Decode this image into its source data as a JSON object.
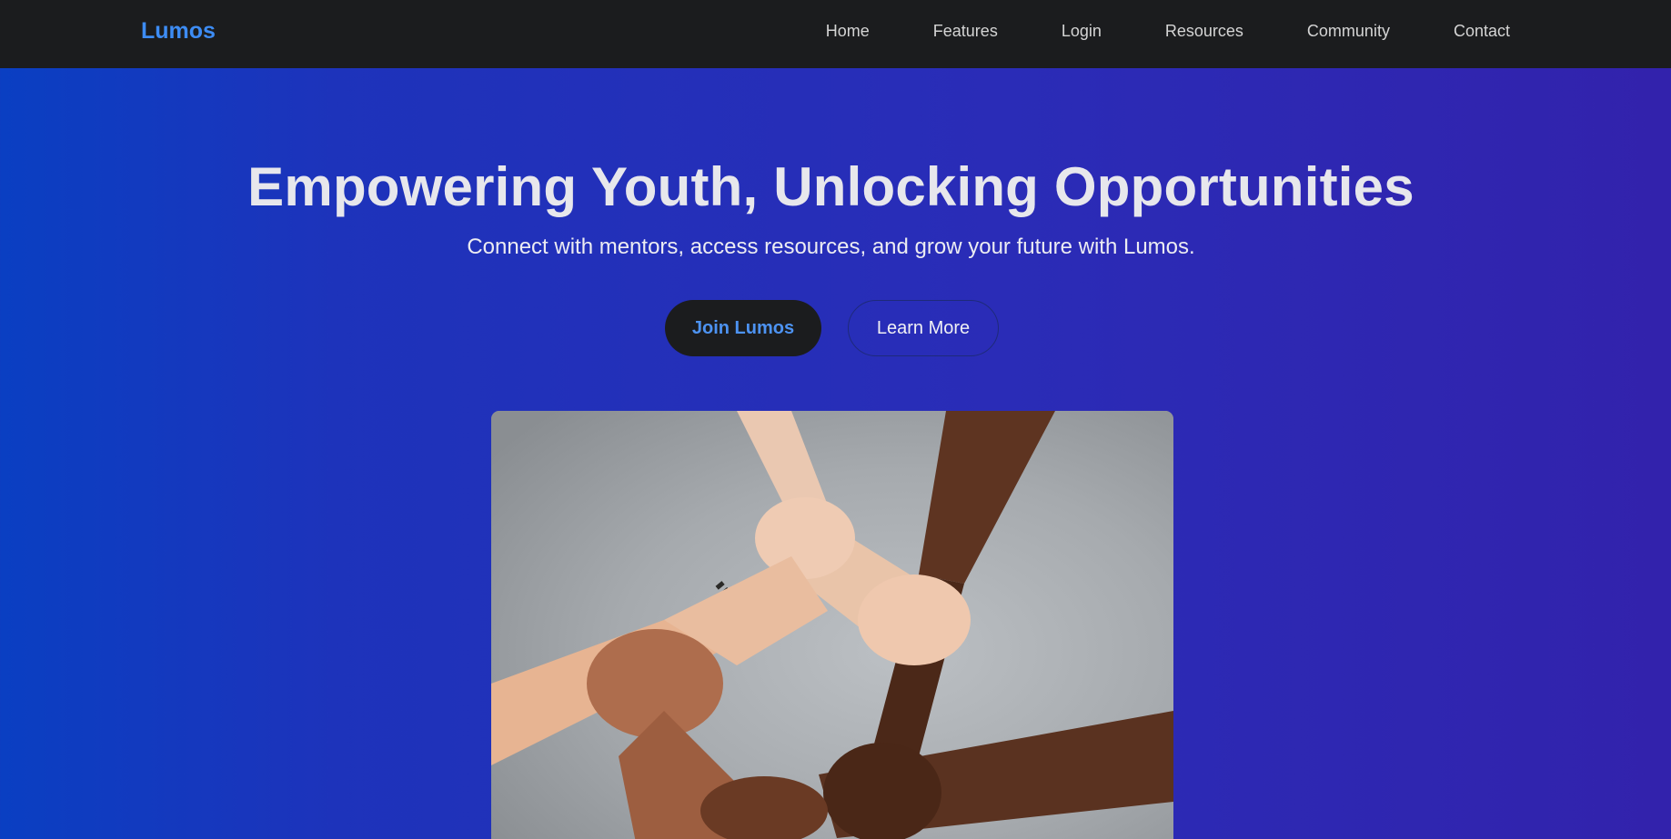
{
  "navbar": {
    "brand": "Lumos",
    "links": [
      "Home",
      "Features",
      "Login",
      "Resources",
      "Community",
      "Contact"
    ]
  },
  "hero": {
    "title": "Empowering Youth, Unlocking Opportunities",
    "subtitle": "Connect with mentors, access resources, and grow your future with Lumos.",
    "primary_button": "Join Lumos",
    "secondary_button": "Learn More",
    "image_icon": "linked-hands-photo"
  },
  "colors": {
    "navbar_bg": "#1b1c1e",
    "brand": "#3d8cf4",
    "hero_gradient_start": "#0a3fc2",
    "hero_gradient_end": "#3222ac",
    "primary_button_bg": "#1b1c1e",
    "primary_button_text": "#4d93f2"
  }
}
